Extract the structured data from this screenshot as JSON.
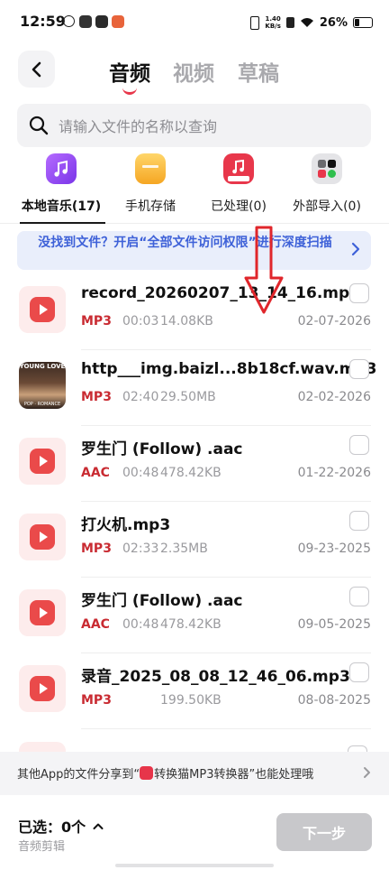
{
  "status_bar": {
    "time": "12:59",
    "net_speed_value": "1.40",
    "net_speed_unit": "KB/s",
    "battery": "26%"
  },
  "header": {
    "tabs": [
      {
        "label": "音频",
        "active": true
      },
      {
        "label": "视频",
        "active": false
      },
      {
        "label": "草稿",
        "active": false
      }
    ]
  },
  "search": {
    "placeholder": "请输入文件的名称以查询",
    "value": ""
  },
  "categories": [
    {
      "label": "本地音乐(17)",
      "icon": "music-note-icon",
      "color": "#9b4df3",
      "active": true
    },
    {
      "label": "手机存储",
      "icon": "folder-icon",
      "color": "#f7b63b",
      "active": false
    },
    {
      "label": "已处理(0)",
      "icon": "mp3-app-icon",
      "color": "#e8374b",
      "active": false
    },
    {
      "label": "外部导入(0)",
      "icon": "apps-grid-icon",
      "color": "#d9d9dc",
      "active": false
    }
  ],
  "banner": {
    "text": "没找到文件？开启“全部文件访问权限”进行深度扫描"
  },
  "files": [
    {
      "name": "record_20260207_13_14_16.mp3",
      "format": "MP3",
      "duration": "00:03",
      "size": "14.08KB",
      "date": "02-07-2026",
      "thumb": "audio"
    },
    {
      "name": "http___img.baizl...8b18cf.wav.mp3",
      "format": "MP3",
      "duration": "02:40",
      "size": "29.50MB",
      "date": "02-02-2026",
      "thumb": "photo",
      "thumb_text_top": "YOUNG LOVE",
      "thumb_text_bottom": "POP · ROMANCE"
    },
    {
      "name": "罗生门 (Follow) .aac",
      "format": "AAC",
      "duration": "00:48",
      "size": "478.42KB",
      "date": "01-22-2026",
      "thumb": "audio"
    },
    {
      "name": "打火机.mp3",
      "format": "MP3",
      "duration": "02:33",
      "size": "2.35MB",
      "date": "09-23-2025",
      "thumb": "audio"
    },
    {
      "name": "罗生门 (Follow) .aac",
      "format": "AAC",
      "duration": "00:48",
      "size": "478.42KB",
      "date": "09-05-2025",
      "thumb": "audio"
    },
    {
      "name": "录音_2025_08_08_12_46_06.mp3",
      "format": "MP3",
      "duration": "",
      "size": "199.50KB",
      "date": "08-08-2025",
      "thumb": "audio"
    }
  ],
  "share_bar": {
    "text_before": "其他App的文件分享到“",
    "app_name": "转换猫MP3转换器",
    "text_after": "”也能处理哦"
  },
  "footer": {
    "selected_label": "已选：0个",
    "edit_label": "音频剪辑",
    "next_label": "下一步"
  },
  "colors": {
    "accent": "#e8374b",
    "banner_text": "#3e61d8",
    "format_text": "#c92b32",
    "annotation_arrow": "#e0262b"
  }
}
